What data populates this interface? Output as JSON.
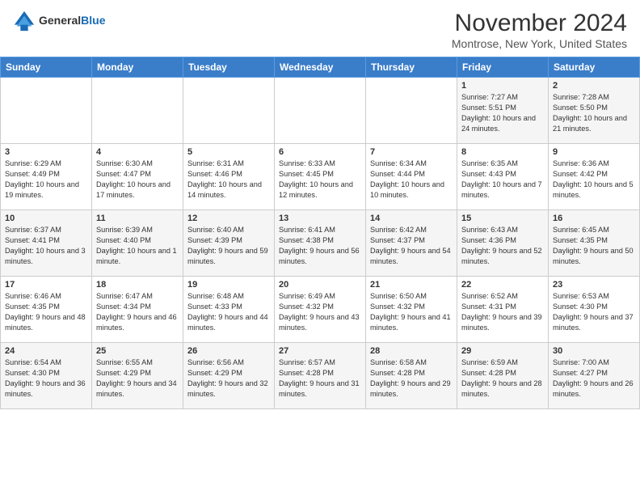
{
  "header": {
    "logo_general": "General",
    "logo_blue": "Blue",
    "month_title": "November 2024",
    "location": "Montrose, New York, United States"
  },
  "weekdays": [
    "Sunday",
    "Monday",
    "Tuesday",
    "Wednesday",
    "Thursday",
    "Friday",
    "Saturday"
  ],
  "weeks": [
    [
      {
        "day": "",
        "info": ""
      },
      {
        "day": "",
        "info": ""
      },
      {
        "day": "",
        "info": ""
      },
      {
        "day": "",
        "info": ""
      },
      {
        "day": "",
        "info": ""
      },
      {
        "day": "1",
        "info": "Sunrise: 7:27 AM\nSunset: 5:51 PM\nDaylight: 10 hours and 24 minutes."
      },
      {
        "day": "2",
        "info": "Sunrise: 7:28 AM\nSunset: 5:50 PM\nDaylight: 10 hours and 21 minutes."
      }
    ],
    [
      {
        "day": "3",
        "info": "Sunrise: 6:29 AM\nSunset: 4:49 PM\nDaylight: 10 hours and 19 minutes."
      },
      {
        "day": "4",
        "info": "Sunrise: 6:30 AM\nSunset: 4:47 PM\nDaylight: 10 hours and 17 minutes."
      },
      {
        "day": "5",
        "info": "Sunrise: 6:31 AM\nSunset: 4:46 PM\nDaylight: 10 hours and 14 minutes."
      },
      {
        "day": "6",
        "info": "Sunrise: 6:33 AM\nSunset: 4:45 PM\nDaylight: 10 hours and 12 minutes."
      },
      {
        "day": "7",
        "info": "Sunrise: 6:34 AM\nSunset: 4:44 PM\nDaylight: 10 hours and 10 minutes."
      },
      {
        "day": "8",
        "info": "Sunrise: 6:35 AM\nSunset: 4:43 PM\nDaylight: 10 hours and 7 minutes."
      },
      {
        "day": "9",
        "info": "Sunrise: 6:36 AM\nSunset: 4:42 PM\nDaylight: 10 hours and 5 minutes."
      }
    ],
    [
      {
        "day": "10",
        "info": "Sunrise: 6:37 AM\nSunset: 4:41 PM\nDaylight: 10 hours and 3 minutes."
      },
      {
        "day": "11",
        "info": "Sunrise: 6:39 AM\nSunset: 4:40 PM\nDaylight: 10 hours and 1 minute."
      },
      {
        "day": "12",
        "info": "Sunrise: 6:40 AM\nSunset: 4:39 PM\nDaylight: 9 hours and 59 minutes."
      },
      {
        "day": "13",
        "info": "Sunrise: 6:41 AM\nSunset: 4:38 PM\nDaylight: 9 hours and 56 minutes."
      },
      {
        "day": "14",
        "info": "Sunrise: 6:42 AM\nSunset: 4:37 PM\nDaylight: 9 hours and 54 minutes."
      },
      {
        "day": "15",
        "info": "Sunrise: 6:43 AM\nSunset: 4:36 PM\nDaylight: 9 hours and 52 minutes."
      },
      {
        "day": "16",
        "info": "Sunrise: 6:45 AM\nSunset: 4:35 PM\nDaylight: 9 hours and 50 minutes."
      }
    ],
    [
      {
        "day": "17",
        "info": "Sunrise: 6:46 AM\nSunset: 4:35 PM\nDaylight: 9 hours and 48 minutes."
      },
      {
        "day": "18",
        "info": "Sunrise: 6:47 AM\nSunset: 4:34 PM\nDaylight: 9 hours and 46 minutes."
      },
      {
        "day": "19",
        "info": "Sunrise: 6:48 AM\nSunset: 4:33 PM\nDaylight: 9 hours and 44 minutes."
      },
      {
        "day": "20",
        "info": "Sunrise: 6:49 AM\nSunset: 4:32 PM\nDaylight: 9 hours and 43 minutes."
      },
      {
        "day": "21",
        "info": "Sunrise: 6:50 AM\nSunset: 4:32 PM\nDaylight: 9 hours and 41 minutes."
      },
      {
        "day": "22",
        "info": "Sunrise: 6:52 AM\nSunset: 4:31 PM\nDaylight: 9 hours and 39 minutes."
      },
      {
        "day": "23",
        "info": "Sunrise: 6:53 AM\nSunset: 4:30 PM\nDaylight: 9 hours and 37 minutes."
      }
    ],
    [
      {
        "day": "24",
        "info": "Sunrise: 6:54 AM\nSunset: 4:30 PM\nDaylight: 9 hours and 36 minutes."
      },
      {
        "day": "25",
        "info": "Sunrise: 6:55 AM\nSunset: 4:29 PM\nDaylight: 9 hours and 34 minutes."
      },
      {
        "day": "26",
        "info": "Sunrise: 6:56 AM\nSunset: 4:29 PM\nDaylight: 9 hours and 32 minutes."
      },
      {
        "day": "27",
        "info": "Sunrise: 6:57 AM\nSunset: 4:28 PM\nDaylight: 9 hours and 31 minutes."
      },
      {
        "day": "28",
        "info": "Sunrise: 6:58 AM\nSunset: 4:28 PM\nDaylight: 9 hours and 29 minutes."
      },
      {
        "day": "29",
        "info": "Sunrise: 6:59 AM\nSunset: 4:28 PM\nDaylight: 9 hours and 28 minutes."
      },
      {
        "day": "30",
        "info": "Sunrise: 7:00 AM\nSunset: 4:27 PM\nDaylight: 9 hours and 26 minutes."
      }
    ]
  ]
}
